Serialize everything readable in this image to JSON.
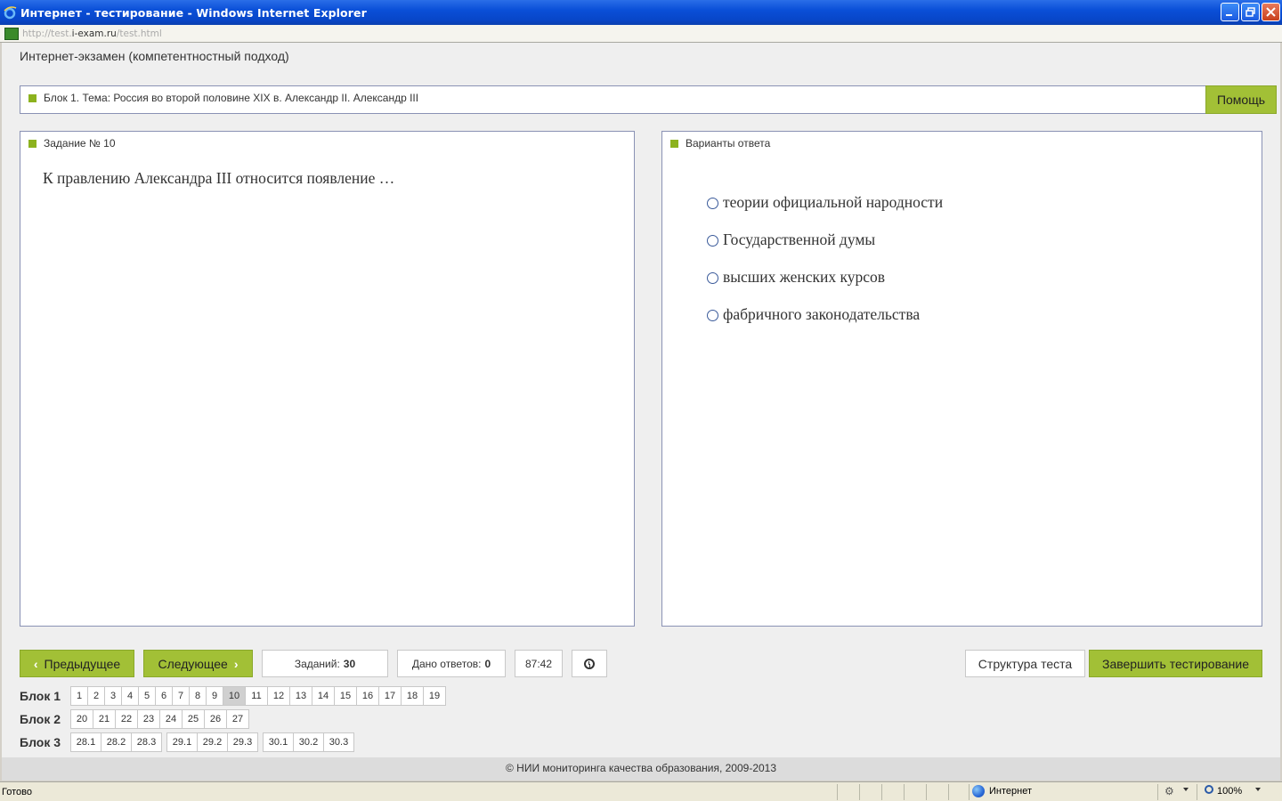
{
  "window": {
    "title": "Интернет - тестирование - Windows Internet Explorer"
  },
  "address": {
    "url_prefix": "http://test.",
    "url_domain": "i-exam.ru",
    "url_suffix": "/test.html"
  },
  "page": {
    "title": "Интернет-экзамен (компетентностный подход)",
    "block_label": "Блок 1. Тема: Россия во второй половине XIX в. Александр II. Александр III",
    "help_label": "Помощь"
  },
  "task": {
    "header": "Задание № 10",
    "question": "К правлению Александра III относится появление …"
  },
  "answers": {
    "header": "Варианты ответа",
    "options": [
      "теории официальной народности",
      "Государственной думы",
      "высших женских курсов",
      "фабричного законодательства"
    ]
  },
  "controls": {
    "prev_label": "Предыдущее",
    "next_label": "Следующее",
    "tasks_label": "Заданий:",
    "tasks_value": "30",
    "answered_label": "Дано ответов:",
    "answered_value": "0",
    "timer": "87:42",
    "structure_label": "Структура теста",
    "finish_label": "Завершить тестирование"
  },
  "blocks": [
    {
      "label": "Блок 1",
      "groups": [
        [
          "1",
          "2",
          "3",
          "4",
          "5",
          "6",
          "7",
          "8",
          "9",
          "10",
          "11",
          "12",
          "13",
          "14",
          "15",
          "16",
          "17",
          "18",
          "19"
        ]
      ],
      "active": "10"
    },
    {
      "label": "Блок 2",
      "groups": [
        [
          "20",
          "21",
          "22",
          "23",
          "24",
          "25",
          "26",
          "27"
        ]
      ],
      "active": ""
    },
    {
      "label": "Блок 3",
      "groups": [
        [
          "28.1",
          "28.2",
          "28.3"
        ],
        [
          "29.1",
          "29.2",
          "29.3"
        ],
        [
          "30.1",
          "30.2",
          "30.3"
        ]
      ],
      "active": ""
    }
  ],
  "footer": "© НИИ мониторинга качества образования, 2009-2013",
  "status": {
    "ready": "Готово",
    "zone": "Интернет",
    "zoom": "100%"
  },
  "colors": {
    "accent": "#a2c036",
    "titlebar": "#0a4fd8",
    "panel_border": "#8a92b4"
  }
}
